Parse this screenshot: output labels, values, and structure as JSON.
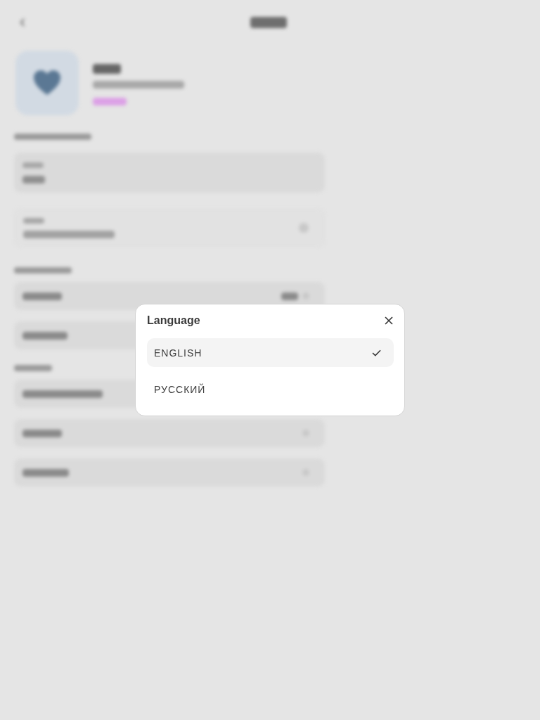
{
  "dialog": {
    "title": "Language",
    "options": [
      {
        "label": "ENGLISH",
        "selected": true
      },
      {
        "label": "РУССКИЙ",
        "selected": false
      }
    ]
  }
}
